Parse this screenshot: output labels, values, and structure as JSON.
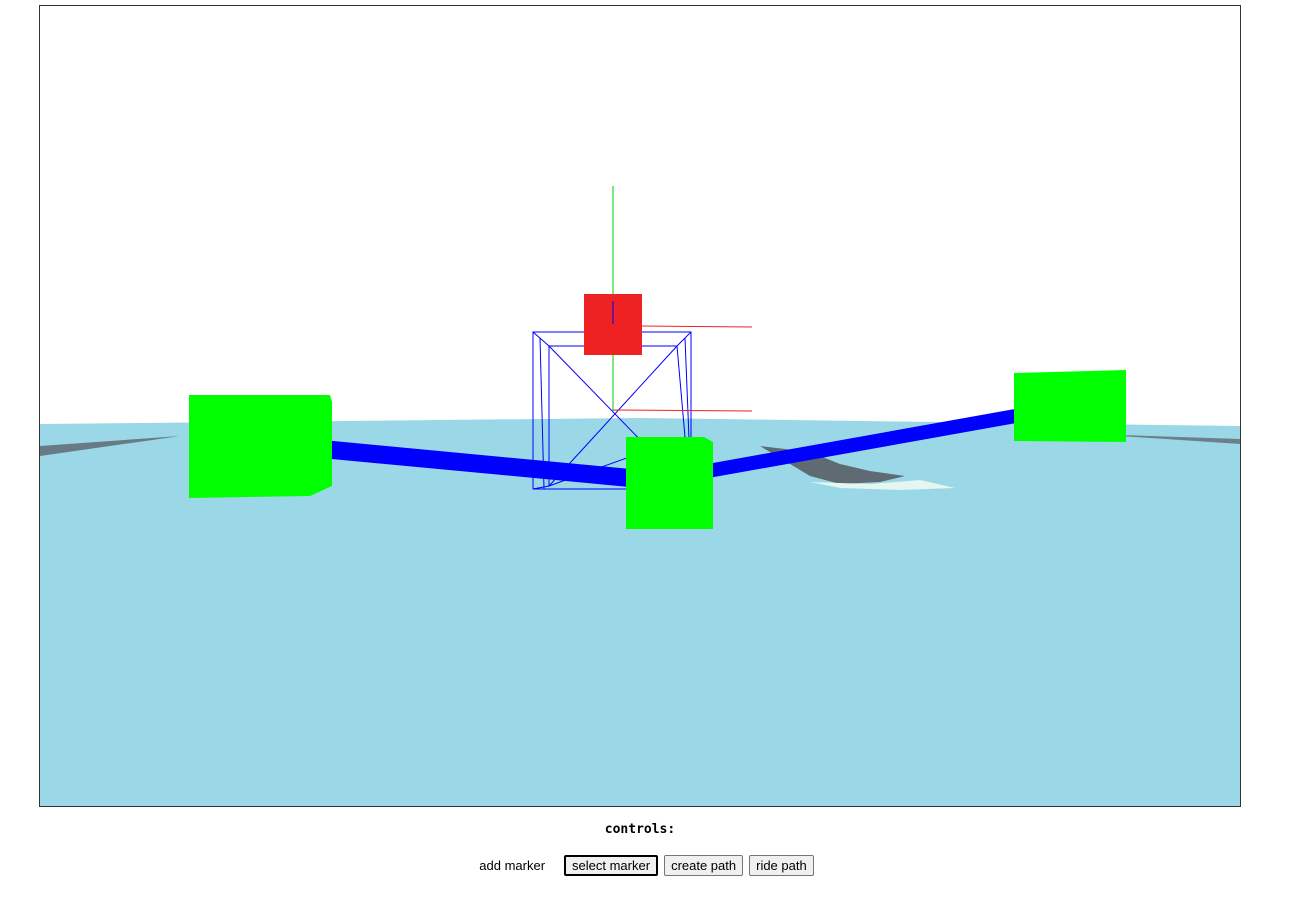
{
  "controls": {
    "heading": "controls:",
    "buttons": [
      {
        "label": "add marker",
        "state": "plain"
      },
      {
        "label": "select marker",
        "state": "active"
      },
      {
        "label": "create path",
        "state": "normal"
      },
      {
        "label": "ride path",
        "state": "normal"
      }
    ]
  },
  "scene": {
    "sky_color": "#ffffff",
    "ground_color": "#9ad8e8",
    "marker_color": "#00ff00",
    "selected_marker_color": "#ee2222",
    "path_color": "#0000ff",
    "selection_box_color": "#0000ff",
    "axis_y_color": "#00cc00",
    "axis_x_color": "#ee2222",
    "terrain_color": "#5f6a72"
  }
}
